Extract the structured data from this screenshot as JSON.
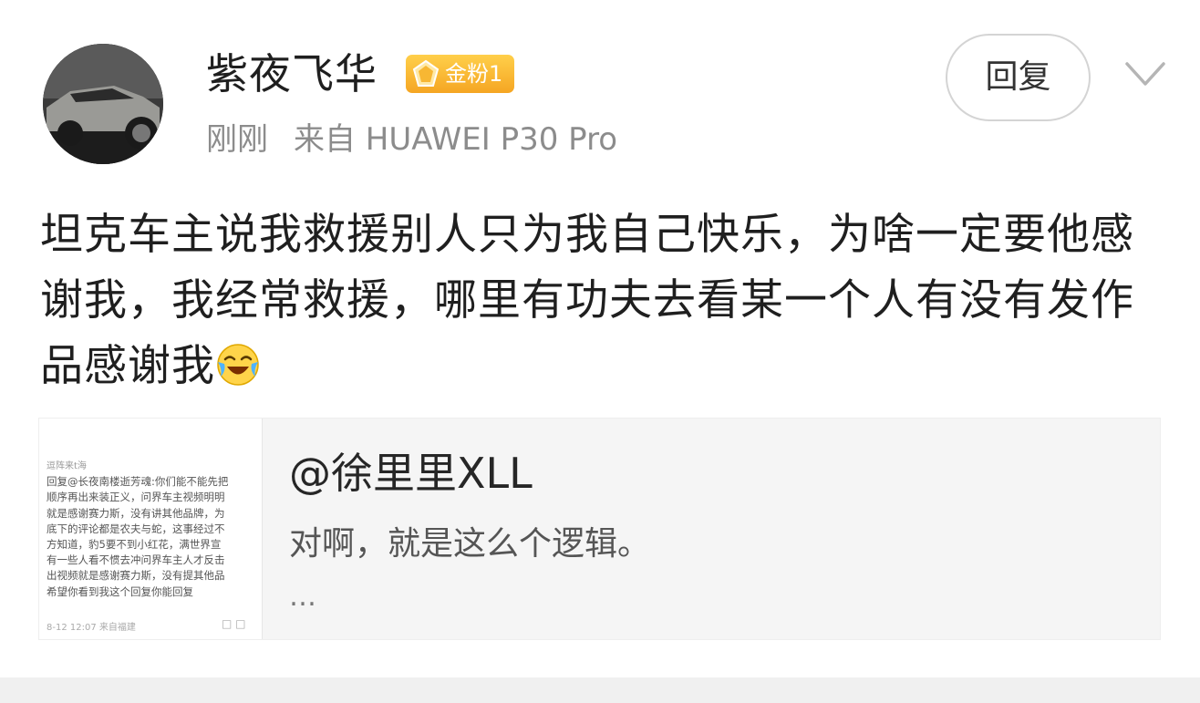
{
  "post": {
    "username": "紫夜飞华",
    "badge": "金粉1",
    "time": "刚刚",
    "source": "来自 HUAWEI P30 Pro",
    "reply_label": "回复",
    "text": "坦克车主说我救援别人只为我自己快乐，为啥一定要他感谢我，我经常救援，哪里有功夫去看某一个人有没有发作品感谢我"
  },
  "quote": {
    "user": "@徐里里XLL",
    "text": "对啊，就是这么个逻辑。",
    "ellipsis": "…",
    "thumbnail": {
      "name": "逗阵来t海",
      "lines": [
        "回复@长夜南楼逝芳魂:你们能不能先把",
        "顺序再出来装正义，问界车主视频明明",
        "就是感谢赛力斯，没有讲其他品牌，为",
        "底下的评论都是农夫与蛇，这事经过不",
        "方知道，豹5要不到小红花，满世界宣",
        "有一些人看不惯去冲问界车主人才反击",
        "出视频就是感谢赛力斯，没有提其他品",
        "希望你看到我这个回复你能回复"
      ],
      "footer": "8-12 12:07  来自福建"
    }
  },
  "icons": {
    "badge": "gold-fan-diamond-icon",
    "more": "chevron-down-icon",
    "emoji": "laugh-cry-emoji-icon"
  },
  "colors": {
    "badge_gold": "#f5a623",
    "meta_gray": "#8c8c8c",
    "card_bg": "#f5f5f5"
  }
}
